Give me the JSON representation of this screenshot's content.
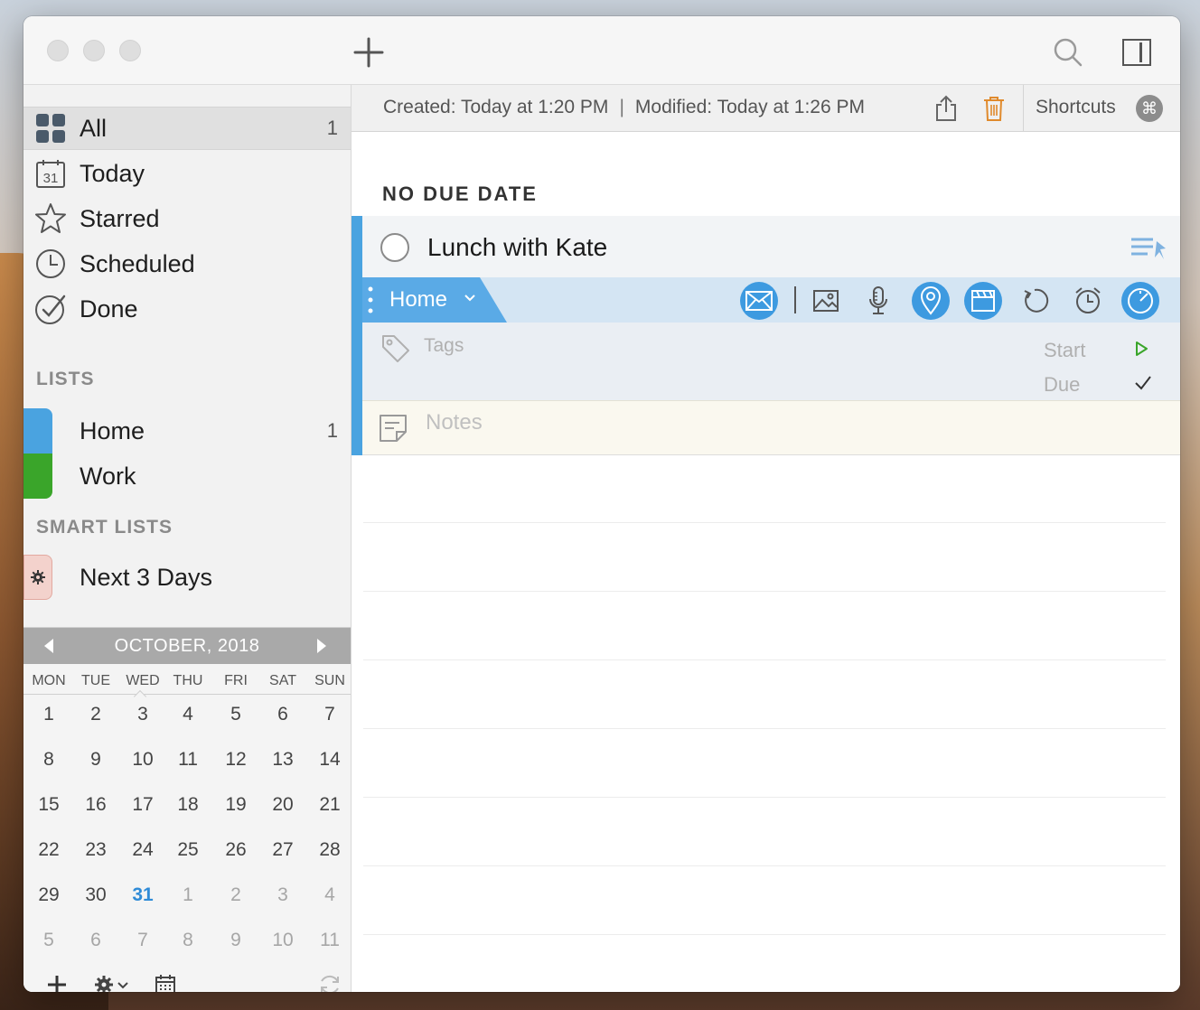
{
  "toolbar": {
    "add_icon": "plus-icon",
    "search_icon": "search-icon",
    "sidebar_toggle_icon": "sidebar-toggle-icon"
  },
  "sidebar": {
    "nav": [
      {
        "label": "All",
        "count": "1",
        "icon": "grid-icon"
      },
      {
        "label": "Today",
        "icon": "calendar-31-icon",
        "icon_text": "31"
      },
      {
        "label": "Starred",
        "icon": "star-icon"
      },
      {
        "label": "Scheduled",
        "icon": "clock-icon"
      },
      {
        "label": "Done",
        "icon": "check-circle-icon"
      }
    ],
    "lists_heading": "LISTS",
    "lists": [
      {
        "label": "Home",
        "count": "1",
        "color": "#4aa3e0"
      },
      {
        "label": "Work",
        "color": "#3aa52a"
      }
    ],
    "smart_lists_heading": "SMART LISTS",
    "smart_lists": [
      {
        "label": "Next 3 Days",
        "icon": "gear-icon",
        "color": "#f3d2cc"
      }
    ]
  },
  "calendar": {
    "month_label": "OCTOBER, 2018",
    "weekdays": [
      "MON",
      "TUE",
      "WED",
      "THU",
      "FRI",
      "SAT",
      "SUN"
    ],
    "weeks": [
      [
        "1",
        "2",
        "3",
        "4",
        "5",
        "6",
        "7"
      ],
      [
        "8",
        "9",
        "10",
        "11",
        "12",
        "13",
        "14"
      ],
      [
        "15",
        "16",
        "17",
        "18",
        "19",
        "20",
        "21"
      ],
      [
        "22",
        "23",
        "24",
        "25",
        "26",
        "27",
        "28"
      ],
      [
        "29",
        "30",
        "31",
        "1",
        "2",
        "3",
        "4"
      ],
      [
        "5",
        "6",
        "7",
        "8",
        "9",
        "10",
        "11"
      ]
    ],
    "selected_weekday": "WED",
    "today": "31",
    "today_color": "#2f8bd7"
  },
  "infobar": {
    "created": "Created: Today at 1:20 PM",
    "separator": "|",
    "modified": "Modified: Today at 1:26 PM",
    "shortcuts_label": "Shortcuts",
    "shortcut_glyph": "⌘"
  },
  "main": {
    "group_heading": "NO DUE DATE",
    "task": {
      "title": "Lunch with Kate",
      "list_name": "Home",
      "accent_color": "#4aa3e0",
      "tags_placeholder": "Tags",
      "start_label": "Start",
      "due_label": "Due",
      "notes_placeholder": "Notes",
      "toolbar_icons": [
        "email-icon",
        "image-icon",
        "microphone-icon",
        "location-pin-icon",
        "clapperboard-icon",
        "repeat-icon",
        "alarm-clock-icon",
        "speedometer-icon"
      ]
    }
  }
}
